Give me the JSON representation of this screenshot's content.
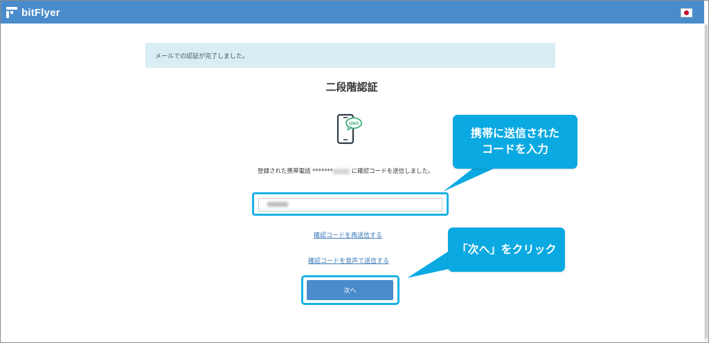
{
  "header": {
    "brand": "bitFlyer",
    "language_flag": "japan-flag-icon"
  },
  "alert": {
    "message": "メールでの認証が完了しました。"
  },
  "page": {
    "title": "二段階認証",
    "icon": "sms-phone-icon",
    "sms_badge": "SMS",
    "description_before": "登録された携帯電話 *******",
    "description_after": " に確認コードを送信しました。",
    "resend_link": "確認コードを再送信する",
    "voice_link": "確認コードを音声で送信する",
    "next_button": "次へ"
  },
  "annotations": {
    "callout_input": "携帯に送信された コードを入力",
    "callout_next": "「次へ」をクリック"
  },
  "colors": {
    "header": "#4a8ccb",
    "alert_bg": "#d9edf4",
    "highlight": "#1ab0e6",
    "callout": "#0aa9e2",
    "button": "#4a8ccb",
    "sms_badge": "#3bb07a"
  }
}
